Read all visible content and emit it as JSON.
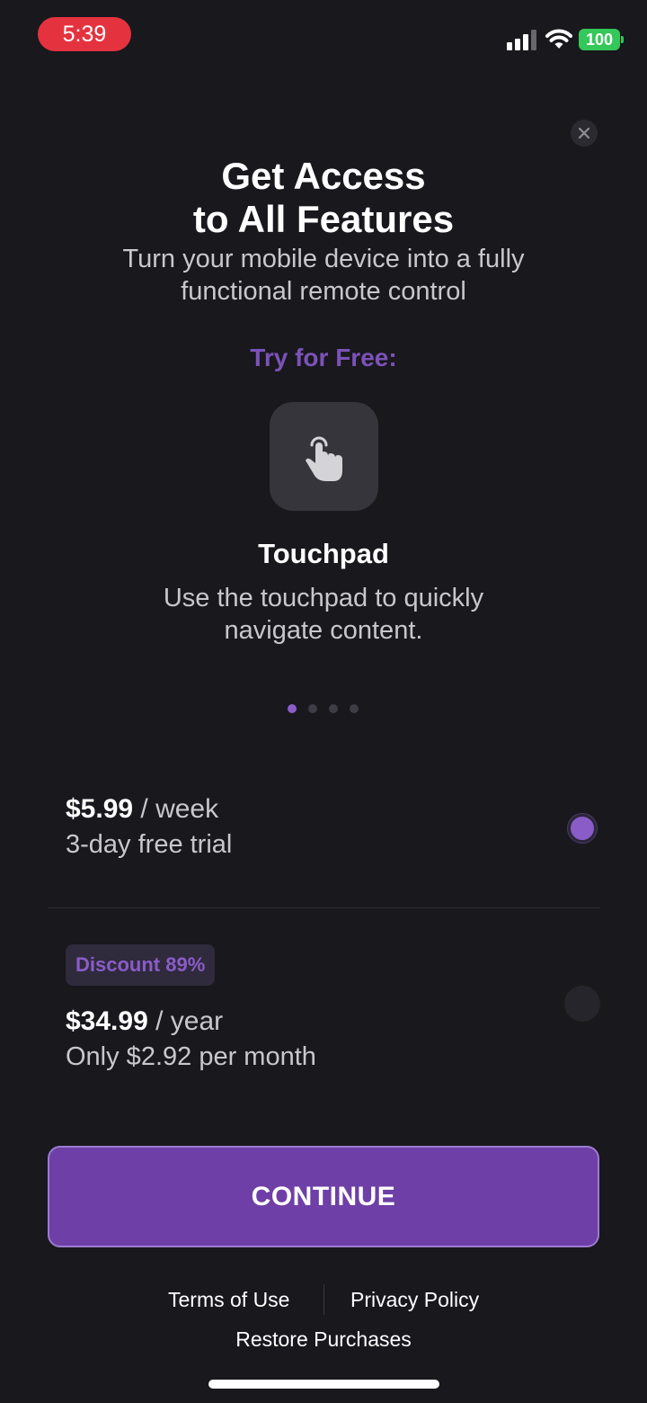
{
  "status_bar": {
    "time": "5:39",
    "battery": "100",
    "icons": [
      "signal-icon",
      "wifi-icon",
      "battery-icon"
    ]
  },
  "paywall": {
    "close_icon": "close-icon",
    "title": "Get Access\nto All Features",
    "subtitle": "Turn your mobile device into a fully functional remote control",
    "try_free_label": "Try for Free:"
  },
  "feature": {
    "icon": "touchpad-hand-icon",
    "title": "Touchpad",
    "description": "Use the touchpad to quickly navigate content.",
    "page_count": 4,
    "active_page": 1
  },
  "plans": [
    {
      "price": "$5.99",
      "period": " / week",
      "note": "3-day free trial",
      "selected": true
    },
    {
      "badge": "Discount 89%",
      "price": "$34.99",
      "period": " / year",
      "note": "Only $2.92 per month",
      "selected": false
    }
  ],
  "cta": {
    "label": "CONTINUE"
  },
  "footer": {
    "terms": "Terms of Use",
    "privacy": "Privacy Policy",
    "restore": "Restore Purchases"
  },
  "colors": {
    "background": "#18181d",
    "accent": "#6e3fa6",
    "accent_light": "#8a5cc8",
    "status_red": "#e5323f",
    "battery_green": "#34c759"
  }
}
